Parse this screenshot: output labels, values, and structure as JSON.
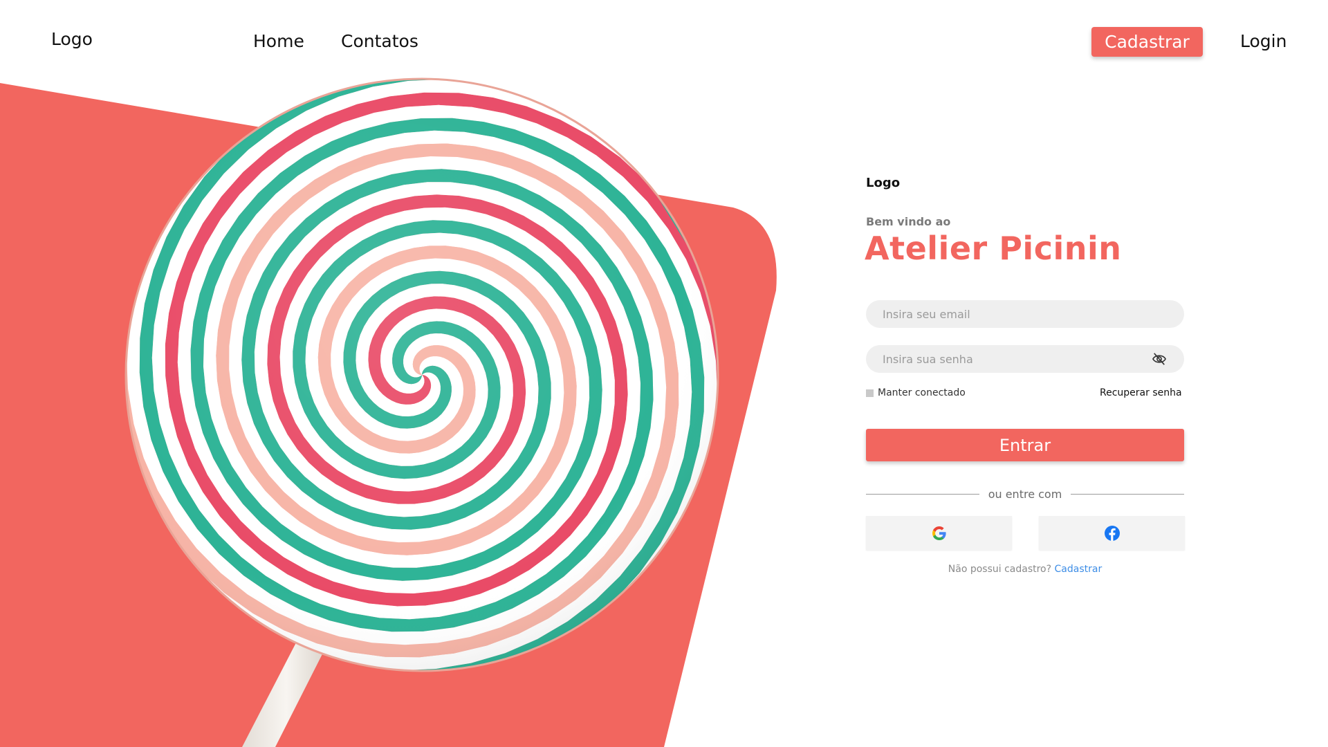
{
  "colors": {
    "accent": "#f2665f",
    "link": "#3d8de6",
    "field_background": "#efefef"
  },
  "header": {
    "logo": "Logo",
    "nav": {
      "home": "Home",
      "contacts": "Contatos"
    },
    "signup_button": "Cadastrar",
    "login_link": "Login"
  },
  "login": {
    "logo": "Logo",
    "welcome": "Bem vindo ao",
    "brand": "Atelier Picinin",
    "email_placeholder": "Insira seu email",
    "password_placeholder": "Insira sua senha",
    "password_toggle_icon": "eye-off-icon",
    "remember_label": "Manter conectado",
    "recover_link": "Recuperar senha",
    "submit_button": "Entrar",
    "divider_text": "ou entre com",
    "social": [
      {
        "provider": "Google",
        "icon": "google-icon"
      },
      {
        "provider": "Facebook",
        "icon": "facebook-icon"
      }
    ],
    "no_account_text": "Não possui cadastro?",
    "signup_link": "Cadastrar"
  },
  "hero": {
    "image": "lollipop-illustration"
  }
}
